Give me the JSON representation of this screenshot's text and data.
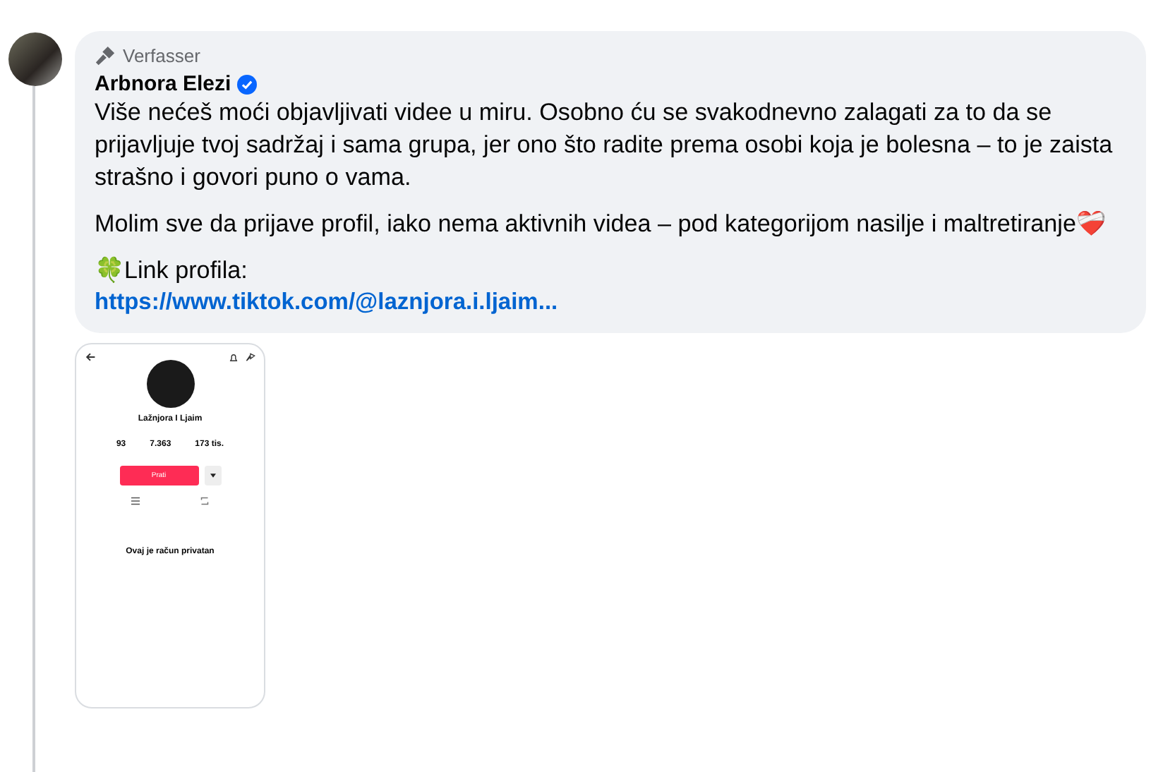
{
  "comment": {
    "badge": "Verfasser",
    "author": "Arbnora Elezi",
    "verified": true,
    "paragraphs": [
      "Više nećeš moći objavljivati videe u miru. Osobno ću se svakodnevno zalagati za to da se prijavljuje tvoj sadržaj i sama grupa, jer ono što radite prema osobi koja je bolesna – to je zaista strašno i govori puno o vama.",
      "Molim sve da prijave profil, iako nema aktivnih videa – pod kategorijom nasilje i maltretiranje❤️‍🩹"
    ],
    "link_label": "🍀Link profila:",
    "link": "https://www.tiktok.com/@laznjora.i.ljaim..."
  },
  "attachment": {
    "profile_name": "Lažnjora I Ljaim",
    "stats": [
      "93",
      "7.363",
      "173 tis."
    ],
    "follow_button": "Prati",
    "private_title": "Ovaj je račun privatan"
  }
}
